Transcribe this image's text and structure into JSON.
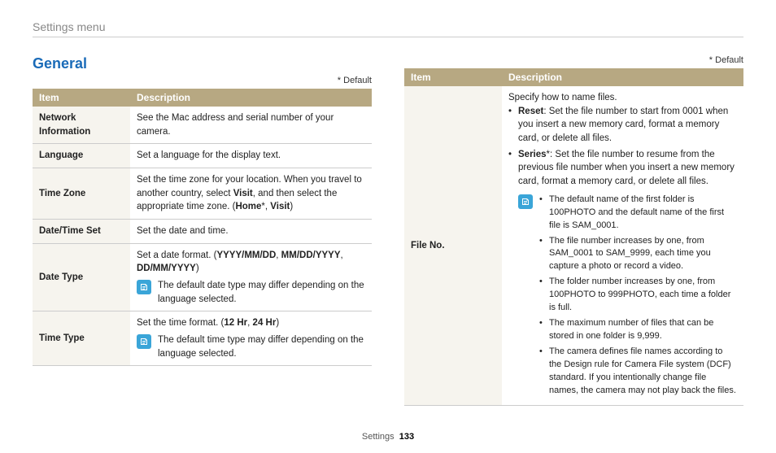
{
  "breadcrumb": "Settings menu",
  "section_title": "General",
  "default_note": "* Default",
  "headers": {
    "item": "Item",
    "desc": "Description"
  },
  "left": {
    "rows": [
      {
        "item": "Network Information",
        "desc_html": "See the Mac address and serial number of your camera."
      },
      {
        "item": "Language",
        "desc_html": "Set a language for the display text."
      },
      {
        "item": "Time Zone",
        "desc_html": "Set the time zone for your location. When you travel to another country, select <b>Visit</b>, and then select the appropriate time zone. (<b>Home</b>*, <b>Visit</b>)"
      },
      {
        "item": "Date/Time Set",
        "desc_html": "Set the date and time."
      },
      {
        "item": "Date Type",
        "desc_html": "Set a date format. (<b>YYYY/MM/DD</b>, <b>MM/DD/YYYY</b>, <b>DD/MM/YYYY</b>)",
        "note": "The default date type may differ depending on the language selected."
      },
      {
        "item": "Time Type",
        "desc_html": "Set the time format. (<b>12 Hr</b>, <b>24 Hr</b>)",
        "note": "The default time type may differ depending on the language selected."
      }
    ]
  },
  "right": {
    "row": {
      "item": "File No.",
      "intro": "Specify how to name files.",
      "bullets": [
        "<b>Reset</b>: Set the file number to start from 0001 when you insert a new memory card, format a memory card, or delete all files.",
        "<b>Series</b>*: Set the file number to resume from the previous file number when you insert a new memory card, format a memory card, or delete all files."
      ],
      "note_bullets": [
        "The default name of the first folder is 100PHOTO and the default name of the first file is SAM_0001.",
        "The file number increases by one, from SAM_0001 to SAM_9999, each time you capture a photo or record a video.",
        "The folder number increases by one, from 100PHOTO to 999PHOTO, each time a folder is full.",
        "The maximum number of files that can be stored in one folder is 9,999.",
        "The camera defines file names according to the Design rule for Camera File system (DCF) standard. If you intentionally change file names, the camera may not play back the files."
      ]
    }
  },
  "footer": {
    "section": "Settings",
    "page": "133"
  }
}
